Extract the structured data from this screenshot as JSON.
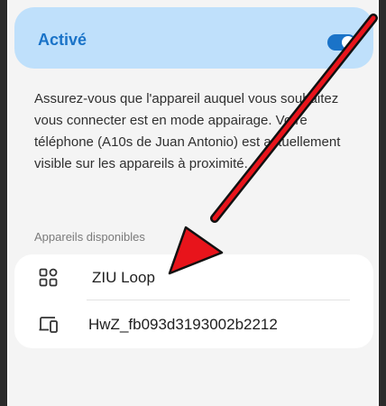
{
  "bluetooth": {
    "status_label": "Activé",
    "enabled": true
  },
  "description": "Assurez-vous que l'appareil auquel vous souhaitez vous connecter est en mode appairage. Votre téléphone (A10s de Juan Antonio) est actuellement visible sur les appareils à proximité.",
  "available_section": {
    "title": "Appareils disponibles"
  },
  "devices": [
    {
      "name": "ZIU Loop",
      "icon": "apps-grid-icon"
    },
    {
      "name": "HwZ_fb093d3193002b2212",
      "icon": "devices-icon"
    }
  ],
  "colors": {
    "accent": "#1a73c8",
    "toggle_card": "#bfe0fb",
    "arrow": "#e8141b"
  }
}
